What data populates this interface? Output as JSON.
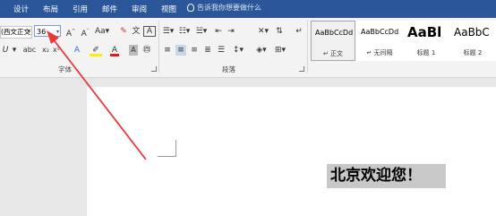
{
  "tabs": [
    "设计",
    "布局",
    "引用",
    "邮件",
    "审阅",
    "视图"
  ],
  "tell_me": "告诉我你想要做什么",
  "font": {
    "name": "(西文正文)",
    "size": "36"
  },
  "groups": {
    "font": "字体",
    "paragraph": "段落"
  },
  "styles": [
    {
      "preview": "AaBbCcDd",
      "name": "↵ 正文"
    },
    {
      "preview": "AaBbCcDd",
      "name": "↵ 无间隔"
    },
    {
      "preview": "AaBl",
      "name": "标题 1"
    },
    {
      "preview": "AaBbC",
      "name": "标题 2"
    }
  ],
  "document": {
    "text": "北京欢迎您！"
  },
  "colors": {
    "tab_bar": "#2b579a",
    "arrow": "#e8383d",
    "highlight": "#c8c8c8"
  }
}
